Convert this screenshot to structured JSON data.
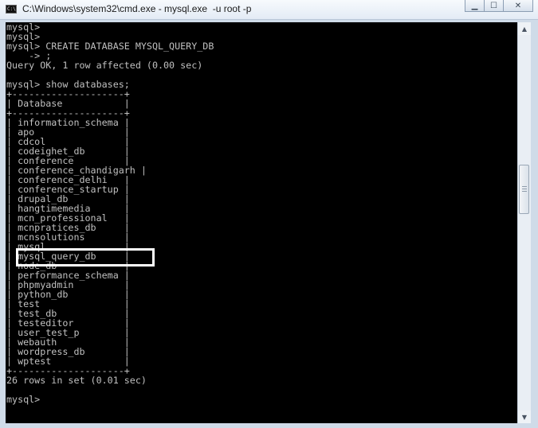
{
  "window": {
    "title": "C:\\Windows\\system32\\cmd.exe - mysql.exe  -u root -p",
    "icon_text": "C:\\",
    "controls": {
      "minimize": "▁",
      "maximize": "☐",
      "close": "✕"
    }
  },
  "console": {
    "lines": [
      "mysql>",
      "mysql>",
      "mysql> CREATE DATABASE MYSQL_QUERY_DB",
      "    -> ;",
      "Query OK, 1 row affected (0.00 sec)",
      "",
      "mysql> show databases;",
      "+--------------------+",
      "| Database           |",
      "+--------------------+",
      "| information_schema |",
      "| apo                |",
      "| cdcol              |",
      "| codeighet_db       |",
      "| conference         |",
      "| conference_chandigarh |",
      "| conference_delhi   |",
      "| conference_startup |",
      "| drupal_db          |",
      "| hangtimemedia      |",
      "| mcn_professional   |",
      "| mcnpratices_db     |",
      "| mcnsolutions       |",
      "| mysql              |",
      "| mysql_query_db     |",
      "| node_db            |",
      "| performance_schema |",
      "| phpmyadmin         |",
      "| python_db          |",
      "| test               |",
      "| test_db            |",
      "| testeditor         |",
      "| user_test_p        |",
      "| webauth            |",
      "| wordpress_db       |",
      "| wptest             |",
      "+--------------------+",
      "26 rows in set (0.01 sec)",
      "",
      "mysql>"
    ],
    "highlighted_item": "mysql_query_db"
  },
  "colors": {
    "console_background": "#000000",
    "console_text": "#c0c0c0",
    "highlight_border": "#ffffff"
  },
  "icons": {
    "scroll_up": "up-arrow-icon",
    "scroll_down": "down-arrow-icon"
  }
}
